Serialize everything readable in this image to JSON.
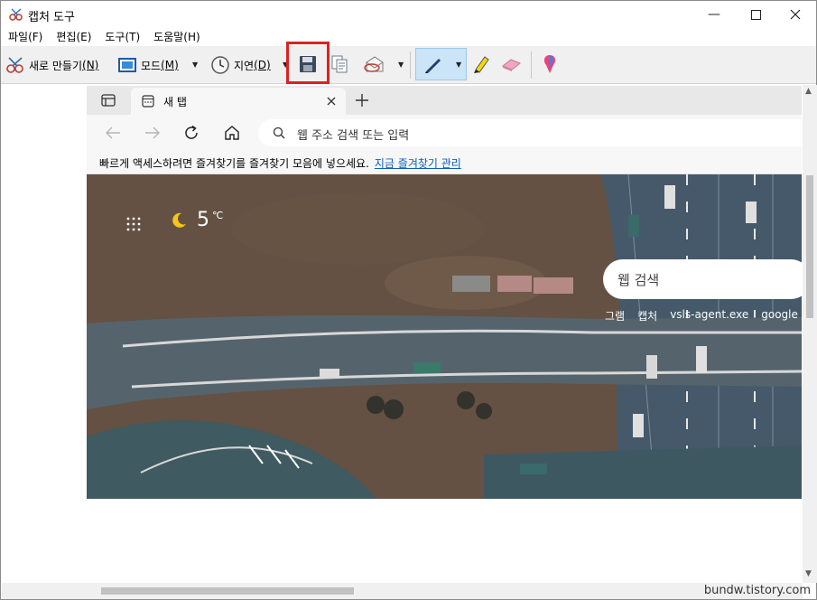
{
  "window": {
    "title": "캡처 도구"
  },
  "menu": [
    "파일(F)",
    "편집(E)",
    "도구(T)",
    "도움말(H)"
  ],
  "toolbar": {
    "new_label": "새로 만들기",
    "new_key": "(N)",
    "mode_label": "모드",
    "mode_key": "(M)",
    "delay_label": "지연",
    "delay_key": "(D)"
  },
  "browser": {
    "tab_label": "새 탭",
    "omnibox_placeholder": "웹 주소 검색 또는 입력",
    "favbar_message": "빠르게 액세스하려면 즐겨찾기를 즐겨찾기 모음에 넣으세요.",
    "favbar_link": "지금 즐겨찾기 관리",
    "weather_temp": "5",
    "weather_unit": "℃",
    "search_placeholder": "웹 검색",
    "quicklinks": [
      "그램",
      "캡처",
      "vsls-agent.exe",
      "google"
    ]
  },
  "watermark": "bundw.tistory.com",
  "colors": {
    "highlight": "#e02020",
    "link": "#0b5fc1",
    "selected_tool": "#cce4f7"
  }
}
